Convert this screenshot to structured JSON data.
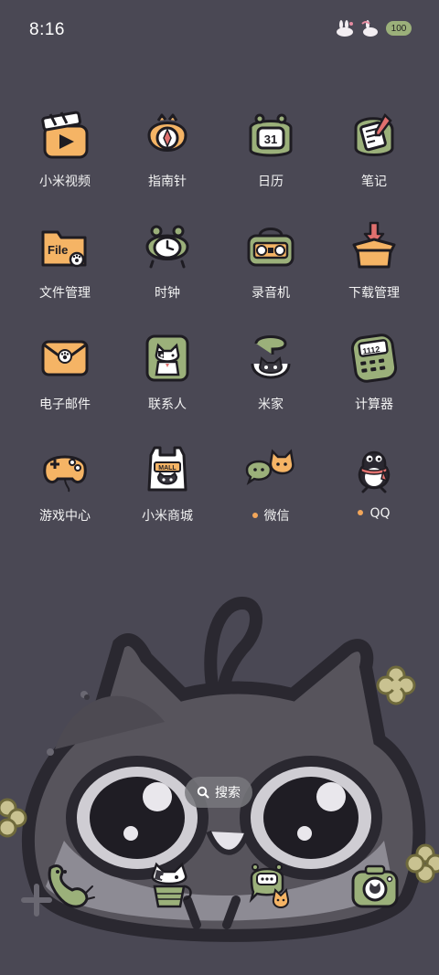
{
  "status_bar": {
    "time": "8:16",
    "battery": "100"
  },
  "apps": [
    {
      "label": "小米视频",
      "icon": "video-clapper-icon",
      "dot": false
    },
    {
      "label": "指南针",
      "icon": "compass-icon",
      "dot": false
    },
    {
      "label": "日历",
      "icon": "calendar-icon",
      "dot": false,
      "day": "31"
    },
    {
      "label": "笔记",
      "icon": "notes-icon",
      "dot": false
    },
    {
      "label": "文件管理",
      "icon": "file-folder-icon",
      "dot": false,
      "folder_text": "File"
    },
    {
      "label": "时钟",
      "icon": "clock-icon",
      "dot": false
    },
    {
      "label": "录音机",
      "icon": "recorder-icon",
      "dot": false
    },
    {
      "label": "下载管理",
      "icon": "download-box-icon",
      "dot": false
    },
    {
      "label": "电子邮件",
      "icon": "mail-envelope-icon",
      "dot": false
    },
    {
      "label": "联系人",
      "icon": "contacts-cat-icon",
      "dot": false
    },
    {
      "label": "米家",
      "icon": "mijia-cat-icon",
      "dot": false
    },
    {
      "label": "计算器",
      "icon": "calculator-icon",
      "dot": false,
      "display": "1112"
    },
    {
      "label": "游戏中心",
      "icon": "gamepad-icon",
      "dot": false
    },
    {
      "label": "小米商城",
      "icon": "shopping-bag-icon",
      "dot": false,
      "bag_text": "MALL"
    },
    {
      "label": "微信",
      "icon": "wechat-bubbles-icon",
      "dot": true
    },
    {
      "label": "QQ",
      "icon": "qq-penguin-icon",
      "dot": true
    }
  ],
  "search": {
    "label": "搜索",
    "icon": "search-icon"
  },
  "dock": [
    {
      "icon": "phone-icon"
    },
    {
      "icon": "browser-cat-icon"
    },
    {
      "icon": "messages-icon"
    },
    {
      "icon": "camera-icon"
    }
  ],
  "colors": {
    "background": "#4a4854",
    "icon_green": "#9bb07a",
    "icon_orange": "#f5b465",
    "outline": "#1e1c22",
    "notification_dot": "#f2a65a"
  }
}
